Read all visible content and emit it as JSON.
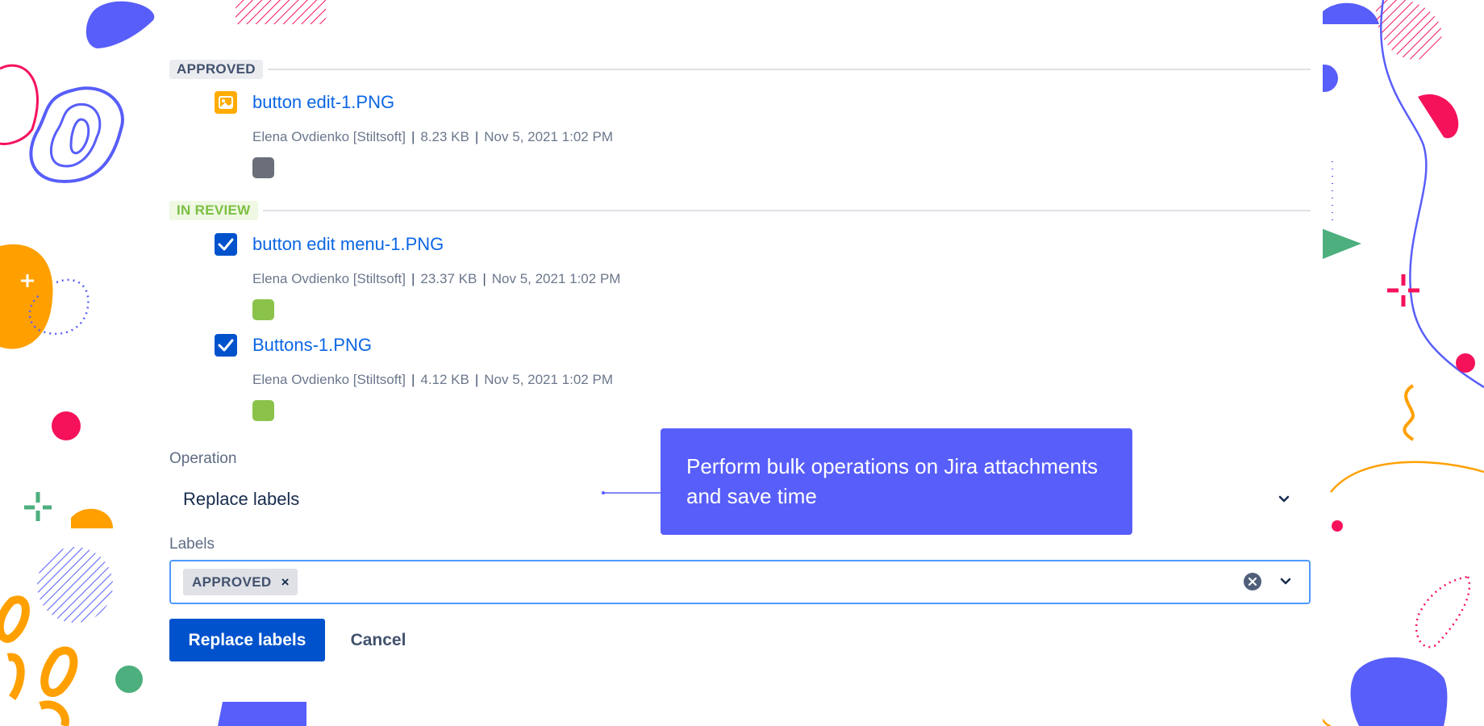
{
  "groups": [
    {
      "status": "APPROVED",
      "attachments": [
        {
          "name": "button edit-1.PNG",
          "author": "Elena Ovdienko [Stiltsoft]",
          "size": "8.23 KB",
          "date": "Nov 5, 2021 1:02 PM",
          "icon": "image-thumbnail-icon",
          "checked": false,
          "status_color": "#6b6f7a"
        }
      ]
    },
    {
      "status": "IN REVIEW",
      "attachments": [
        {
          "name": "button edit menu-1.PNG",
          "author": "Elena Ovdienko [Stiltsoft]",
          "size": "23.37 KB",
          "date": "Nov 5, 2021 1:02 PM",
          "icon": "checkbox-checked-icon",
          "checked": true,
          "status_color": "#8bc34a"
        },
        {
          "name": "Buttons-1.PNG",
          "author": "Elena Ovdienko [Stiltsoft]",
          "size": "4.12 KB",
          "date": "Nov 5, 2021 1:02 PM",
          "icon": "checkbox-checked-icon",
          "checked": true,
          "status_color": "#8bc34a"
        }
      ]
    }
  ],
  "meta_separator": "|",
  "operation": {
    "label": "Operation",
    "value": "Replace labels"
  },
  "labels": {
    "label": "Labels",
    "chips": [
      "APPROVED"
    ],
    "remove_glyph": "×"
  },
  "actions": {
    "primary": "Replace labels",
    "cancel": "Cancel"
  },
  "callout": {
    "text": "Perform bulk operations on Jira attachments and save time"
  },
  "colors": {
    "link": "#0b66e4",
    "primary_button": "#0052cc",
    "callout_bg": "#585ef9",
    "approved_lozenge_text": "#42526e",
    "inreview_lozenge_text": "#7cbf42",
    "input_focus_border": "#4c9aff"
  }
}
